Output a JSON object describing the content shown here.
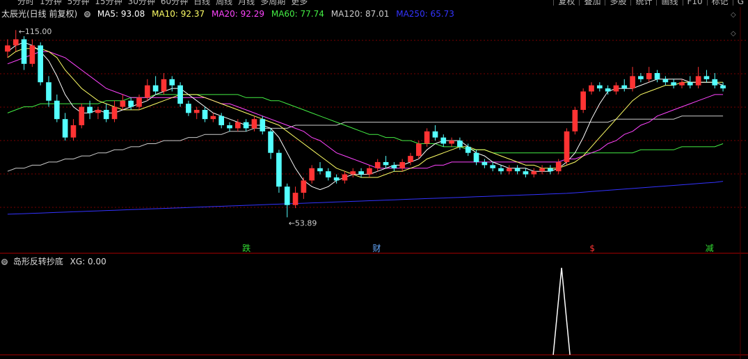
{
  "topbar": {
    "periods": [
      "分时",
      "1分钟",
      "5分钟",
      "15分钟",
      "30分钟",
      "60分钟",
      "日线",
      "周线",
      "月线",
      "多周期",
      "更多"
    ],
    "tools": [
      "复权",
      "叠加",
      "多股",
      "统计",
      "画线",
      "F10",
      "标记",
      "G"
    ]
  },
  "legend": {
    "stock": "太辰光(日线 前复权)",
    "ma5": "MA5: 93.08",
    "ma10": "MA10: 92.37",
    "ma20": "MA20: 92.29",
    "ma60": "MA60: 77.74",
    "ma120": "MA120: 87.01",
    "ma250": "MA250: 65.73"
  },
  "indicator": {
    "label": "岛形反转抄底",
    "xg": "XG: 0.00"
  },
  "markers": {
    "die": "跌",
    "cai": "财",
    "s": "$",
    "jian": "减"
  },
  "colors": {
    "up": "#ff3333",
    "down": "#54ffff",
    "ma5": "#ffffff",
    "ma10": "#ffff66",
    "ma20": "#ff44ff",
    "ma60": "#44ee44",
    "ma120": "#cccccc",
    "ma250": "#3333ff"
  },
  "chart_data": {
    "type": "candlestick",
    "y_range": [
      50,
      118
    ],
    "high_label": "115.00",
    "low_label": "53.89",
    "candles": [
      [
        108,
        110,
        106,
        112
      ],
      [
        110,
        112,
        108,
        115
      ],
      [
        112,
        104,
        102,
        113
      ],
      [
        104,
        110,
        103,
        112
      ],
      [
        110,
        98,
        97,
        111
      ],
      [
        98,
        92,
        90,
        100
      ],
      [
        92,
        86,
        85,
        94
      ],
      [
        86,
        80,
        79,
        88
      ],
      [
        80,
        84,
        79,
        86
      ],
      [
        84,
        90,
        83,
        91
      ],
      [
        90,
        88,
        86,
        92
      ],
      [
        88,
        89,
        86,
        90
      ],
      [
        89,
        86,
        85,
        91
      ],
      [
        86,
        90,
        85,
        92
      ],
      [
        90,
        92,
        89,
        94
      ],
      [
        92,
        90,
        89,
        93
      ],
      [
        90,
        93,
        89,
        94
      ],
      [
        93,
        97,
        92,
        99
      ],
      [
        97,
        95,
        94,
        100
      ],
      [
        95,
        99,
        94,
        101
      ],
      [
        99,
        97,
        95,
        100
      ],
      [
        97,
        91,
        90,
        98
      ],
      [
        91,
        88,
        87,
        92
      ],
      [
        88,
        89,
        86,
        90
      ],
      [
        89,
        86,
        85,
        90
      ],
      [
        86,
        87,
        85,
        88
      ],
      [
        87,
        84,
        83,
        88
      ],
      [
        84,
        83,
        82,
        85
      ],
      [
        83,
        85,
        82,
        86
      ],
      [
        85,
        83,
        82,
        86
      ],
      [
        83,
        86,
        82,
        87
      ],
      [
        86,
        82,
        81,
        87
      ],
      [
        82,
        75,
        73,
        83
      ],
      [
        75,
        64,
        62,
        76
      ],
      [
        64,
        58,
        54,
        65
      ],
      [
        58,
        62,
        57,
        64
      ],
      [
        62,
        66,
        60,
        67
      ],
      [
        66,
        70,
        65,
        71
      ],
      [
        70,
        69,
        68,
        72
      ],
      [
        69,
        67,
        66,
        70
      ],
      [
        67,
        66,
        65,
        68
      ],
      [
        66,
        68,
        65,
        69
      ],
      [
        68,
        69,
        67,
        70
      ],
      [
        69,
        68,
        67,
        70
      ],
      [
        68,
        70,
        67,
        71
      ],
      [
        70,
        72,
        69,
        73
      ],
      [
        72,
        71,
        70,
        74
      ],
      [
        71,
        70,
        69,
        72
      ],
      [
        70,
        72,
        69,
        73
      ],
      [
        72,
        74,
        71,
        75
      ],
      [
        74,
        78,
        73,
        79
      ],
      [
        78,
        82,
        77,
        83
      ],
      [
        82,
        80,
        79,
        84
      ],
      [
        80,
        78,
        77,
        81
      ],
      [
        78,
        79,
        77,
        80
      ],
      [
        79,
        77,
        76,
        80
      ],
      [
        77,
        75,
        74,
        78
      ],
      [
        75,
        72,
        71,
        76
      ],
      [
        72,
        71,
        70,
        73
      ],
      [
        71,
        70,
        69,
        72
      ],
      [
        70,
        69,
        68,
        71
      ],
      [
        69,
        70,
        68,
        71
      ],
      [
        70,
        69,
        68,
        71
      ],
      [
        69,
        68,
        67,
        70
      ],
      [
        68,
        69,
        67,
        70
      ],
      [
        69,
        70,
        68,
        71
      ],
      [
        70,
        69,
        68,
        71
      ],
      [
        69,
        72,
        68,
        73
      ],
      [
        72,
        82,
        71,
        83
      ],
      [
        82,
        89,
        81,
        90
      ],
      [
        89,
        95,
        88,
        96
      ],
      [
        95,
        97,
        94,
        98
      ],
      [
        97,
        96,
        95,
        98
      ],
      [
        96,
        95,
        94,
        97
      ],
      [
        95,
        97,
        94,
        98
      ],
      [
        97,
        96,
        95,
        99
      ],
      [
        96,
        100,
        95,
        103
      ],
      [
        100,
        99,
        98,
        101
      ],
      [
        99,
        101,
        98,
        103
      ],
      [
        101,
        99,
        98,
        102
      ],
      [
        99,
        98,
        97,
        100
      ],
      [
        98,
        97,
        96,
        99
      ],
      [
        97,
        98,
        96,
        99
      ],
      [
        98,
        97,
        96,
        100
      ],
      [
        97,
        100,
        96,
        103
      ],
      [
        100,
        99,
        98,
        102
      ],
      [
        99,
        97,
        96,
        101
      ],
      [
        97,
        96,
        95,
        98
      ]
    ],
    "ma": {
      "ma5": [
        108,
        110,
        111,
        110,
        108,
        105,
        100,
        94,
        90,
        88,
        88,
        89,
        88,
        88,
        89,
        90,
        91,
        92,
        94,
        95,
        96,
        96,
        94,
        92,
        90,
        88,
        87,
        86,
        85,
        84,
        84,
        84,
        83,
        80,
        75,
        70,
        66,
        64,
        63,
        64,
        66,
        67,
        68,
        68,
        68,
        69,
        70,
        71,
        71,
        72,
        73,
        76,
        78,
        79,
        79,
        79,
        77,
        75,
        74,
        72,
        71,
        70,
        70,
        70,
        69,
        69,
        69,
        70,
        72,
        75,
        80,
        86,
        91,
        95,
        96,
        96,
        96,
        97,
        98,
        99,
        99,
        99,
        99,
        98,
        98,
        98,
        98,
        97
      ],
      "ma10": [
        106,
        108,
        109,
        109,
        109,
        108,
        106,
        102,
        99,
        96,
        94,
        92,
        91,
        90,
        89,
        89,
        89,
        90,
        91,
        92,
        93,
        94,
        94,
        94,
        93,
        92,
        91,
        90,
        89,
        88,
        87,
        86,
        85,
        84,
        82,
        80,
        78,
        76,
        74,
        72,
        70,
        69,
        68,
        67,
        67,
        67,
        68,
        69,
        69,
        70,
        71,
        73,
        74,
        75,
        76,
        77,
        77,
        76,
        76,
        75,
        74,
        73,
        72,
        71,
        71,
        70,
        70,
        70,
        71,
        72,
        74,
        77,
        80,
        83,
        86,
        89,
        92,
        94,
        95,
        96,
        97,
        97,
        98,
        98,
        98,
        98,
        98,
        98
      ],
      "ma20": [
        104,
        105,
        106,
        107,
        108,
        108,
        107,
        106,
        104,
        102,
        100,
        98,
        96,
        95,
        94,
        93,
        93,
        93,
        93,
        93,
        93,
        93,
        93,
        93,
        93,
        92,
        91,
        91,
        90,
        89,
        88,
        87,
        86,
        85,
        84,
        83,
        82,
        80,
        79,
        77,
        75,
        74,
        73,
        72,
        71,
        70,
        70,
        70,
        70,
        70,
        70,
        70,
        71,
        71,
        72,
        72,
        72,
        72,
        72,
        72,
        72,
        72,
        72,
        72,
        72,
        72,
        72,
        72,
        73,
        73,
        74,
        75,
        76,
        78,
        79,
        81,
        82,
        84,
        85,
        87,
        88,
        89,
        90,
        91,
        92,
        93,
        94,
        94
      ],
      "ma60": [
        88,
        89,
        90,
        90,
        91,
        91,
        91,
        91,
        91,
        91,
        91,
        91,
        92,
        92,
        92,
        93,
        93,
        93,
        94,
        94,
        94,
        94,
        94,
        94,
        94,
        94,
        94,
        94,
        94,
        93,
        93,
        93,
        92,
        92,
        91,
        90,
        89,
        88,
        87,
        86,
        85,
        84,
        83,
        82,
        81,
        81,
        80,
        80,
        79,
        79,
        78,
        78,
        78,
        77,
        77,
        77,
        76,
        76,
        76,
        75,
        75,
        75,
        75,
        75,
        75,
        75,
        75,
        75,
        75,
        75,
        75,
        75,
        75,
        75,
        75,
        75,
        75,
        76,
        76,
        76,
        76,
        76,
        77,
        77,
        77,
        77,
        77,
        78
      ],
      "ma120": [
        69,
        70,
        70,
        71,
        71,
        72,
        72,
        73,
        73,
        74,
        74,
        75,
        75,
        76,
        76,
        77,
        77,
        78,
        78,
        79,
        79,
        79,
        80,
        80,
        81,
        81,
        81,
        82,
        82,
        82,
        83,
        83,
        83,
        83,
        83,
        84,
        84,
        84,
        84,
        84,
        84,
        85,
        85,
        85,
        85,
        85,
        85,
        85,
        85,
        85,
        85,
        85,
        85,
        85,
        85,
        85,
        85,
        85,
        85,
        85,
        85,
        85,
        85,
        85,
        85,
        85,
        85,
        85,
        85,
        85,
        85,
        85,
        85,
        85,
        86,
        86,
        86,
        86,
        86,
        86,
        86,
        86,
        87,
        87,
        87,
        87,
        87,
        87
      ],
      "ma250": [
        55,
        55.1,
        55.2,
        55.3,
        55.4,
        55.5,
        55.6,
        55.7,
        55.8,
        55.9,
        56,
        56.1,
        56.2,
        56.3,
        56.4,
        56.5,
        56.6,
        56.7,
        56.8,
        56.9,
        57,
        57.1,
        57.2,
        57.3,
        57.4,
        57.5,
        57.6,
        57.7,
        57.8,
        57.9,
        58,
        58.1,
        58.2,
        58.3,
        58.4,
        58.5,
        58.6,
        58.7,
        58.8,
        58.9,
        59,
        59.1,
        59.2,
        59.3,
        59.4,
        59.5,
        59.6,
        59.7,
        59.8,
        59.9,
        60,
        60.1,
        60.2,
        60.3,
        60.4,
        60.5,
        60.6,
        60.7,
        60.8,
        60.9,
        61,
        61.1,
        61.2,
        61.3,
        61.4,
        61.5,
        61.6,
        61.7,
        61.8,
        62,
        62.2,
        62.4,
        62.6,
        62.8,
        63,
        63.2,
        63.4,
        63.6,
        63.8,
        64,
        64.2,
        64.4,
        64.6,
        64.8,
        65,
        65.2,
        65.4,
        65.73
      ]
    },
    "xg": {
      "spike_index": 65,
      "value": 1
    }
  }
}
